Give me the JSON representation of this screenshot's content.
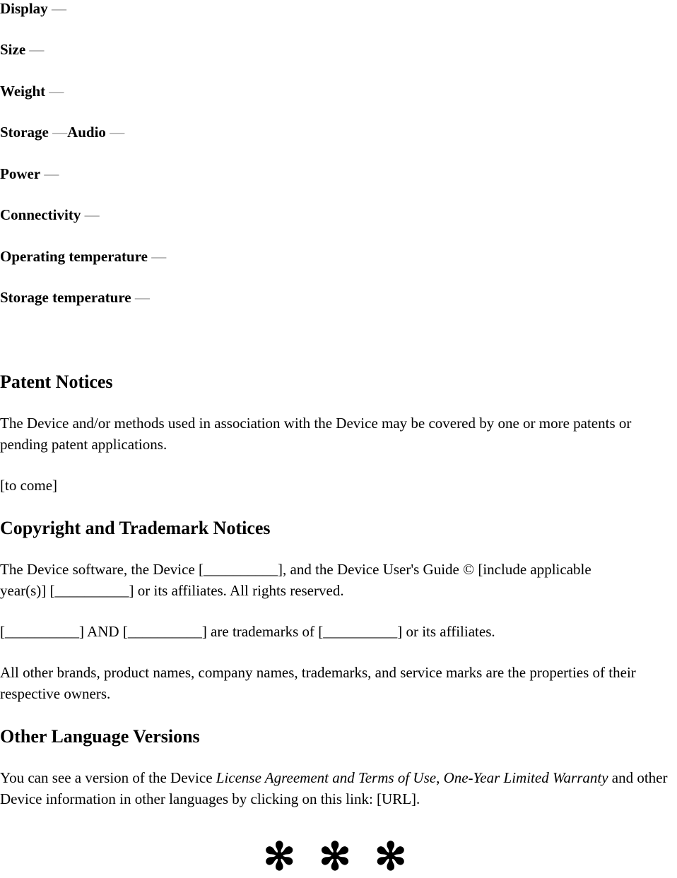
{
  "specs": [
    {
      "label": "Display",
      "value": "—"
    },
    {
      "label": "Size",
      "value": "—"
    },
    {
      "label": "Weight",
      "value": "—"
    },
    {
      "label": "Storage",
      "value": "—",
      "label2": "Audio",
      "value2": "—"
    },
    {
      "label": "Power",
      "value": "—"
    },
    {
      "label": "Connectivity",
      "value": "—"
    },
    {
      "label": "Operating temperature",
      "value": "—"
    },
    {
      "label": "Storage temperature",
      "value": "—"
    }
  ],
  "patent": {
    "heading": "Patent Notices",
    "body": "The Device and/or methods used in association with the Device may be covered by one or more patents or pending patent applications.",
    "placeholder": "[to come]"
  },
  "copyright": {
    "heading": "Copyright and Trademark Notices",
    "p1": "The Device software, the Device [__________], and the Device User's Guide © [include applicable year(s)] [__________] or its affiliates. All rights reserved.",
    "p2": "[__________] AND [__________] are trademarks of [__________] or its affiliates.",
    "p3": "All other brands, product names, company names, trademarks, and service marks are the properties of their respective owners."
  },
  "languages": {
    "heading": "Other Language Versions",
    "text_before": "You can see a version of the Device ",
    "italic1": "License Agreement and Terms of Use",
    "sep": ", ",
    "italic2": "One-Year Limited Warranty",
    "text_after": " and other Device information in other languages by clicking on this link: [URL]."
  },
  "end_marker": "✻ ✻ ✻"
}
